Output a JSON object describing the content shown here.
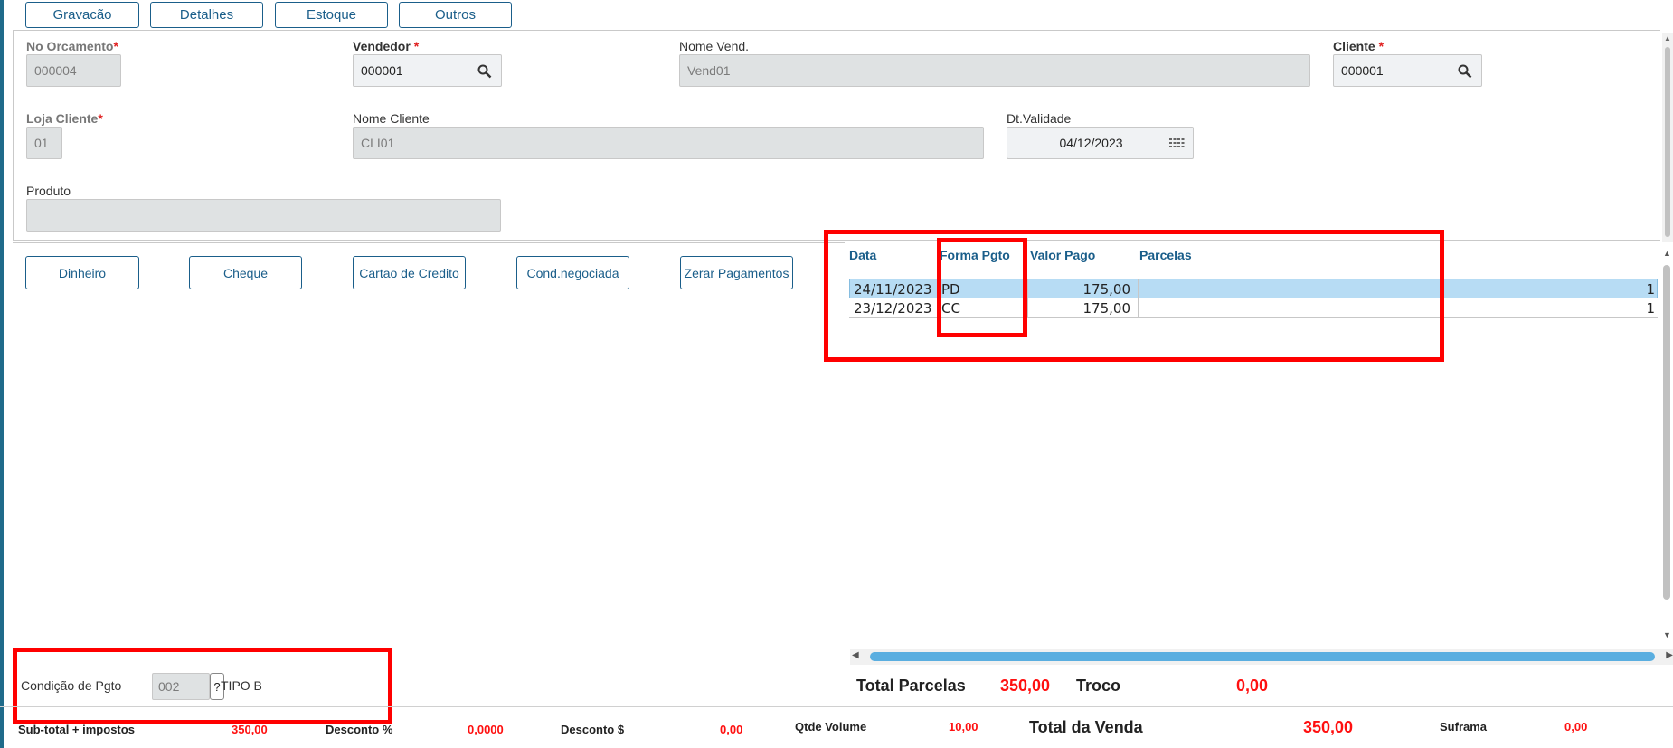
{
  "tabs": [
    "Gravacão",
    "Detalhes",
    "Estoque",
    "Outros"
  ],
  "form": {
    "no_orcamento": {
      "label": "No Orcamento",
      "req": "*",
      "value": "000004"
    },
    "vendedor": {
      "label": "Vendedor",
      "req": "*",
      "value": "000001"
    },
    "nome_vend": {
      "label": "Nome Vend.",
      "value": "Vend01"
    },
    "cliente": {
      "label": "Cliente",
      "req": "*",
      "value": "000001"
    },
    "loja_cliente": {
      "label": "Loja Cliente",
      "req": "*",
      "value": "01"
    },
    "nome_cliente": {
      "label": "Nome Cliente",
      "value": "CLI01"
    },
    "dt_validade": {
      "label": "Dt.Validade",
      "value": "04/12/2023"
    },
    "produto": {
      "label": "Produto",
      "value": ""
    }
  },
  "payment_buttons": [
    {
      "hotkey": "D",
      "rest": "inheiro"
    },
    {
      "hotkey": "C",
      "rest": "heque"
    },
    {
      "pre": "C",
      "hotkey": "a",
      "rest": "rtao de Credito"
    },
    {
      "pre": "Cond.",
      "hotkey": "n",
      "rest": "egociada"
    },
    {
      "hotkey": "Z",
      "rest": "erar Pagamentos"
    }
  ],
  "grid": {
    "columns": [
      "Data",
      "Forma Pgto",
      "Valor Pago",
      "Parcelas"
    ],
    "rows": [
      {
        "data": "24/11/2023",
        "forma": "PD",
        "valor": "175,00",
        "parcelas": "1",
        "selected": true
      },
      {
        "data": "23/12/2023",
        "forma": "CC",
        "valor": "175,00",
        "parcelas": "1",
        "selected": false
      }
    ]
  },
  "condicao": {
    "label": "Condição de Pgto",
    "code": "002",
    "help": "?",
    "desc": "TIPO B"
  },
  "totals": {
    "total_parcelas_label": "Total Parcelas",
    "total_parcelas": "350,00",
    "troco_label": "Troco",
    "troco": "0,00"
  },
  "footer": {
    "subtotal_label": "Sub-total + impostos",
    "subtotal": "350,00",
    "desconto_pct_label": "Desconto %",
    "desconto_pct": "0,0000",
    "desconto_val_label": "Desconto $",
    "desconto_val": "0,00",
    "qtde_volume_label": "Qtde Volume",
    "qtde_volume": "10,00",
    "total_venda_label": "Total da Venda",
    "total_venda": "350,00",
    "suframa_label": "Suframa",
    "suframa": "0,00"
  },
  "colors": {
    "accent": "#1a5e8a",
    "highlight": "#ff0000",
    "selected_row": "#b7dcf4"
  },
  "icons": {
    "lookup": "search-icon",
    "calendar": "calendar-icon"
  }
}
